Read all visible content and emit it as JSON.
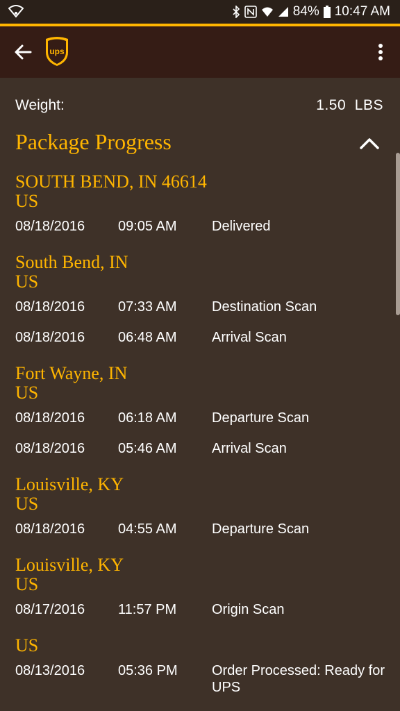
{
  "status_bar": {
    "battery": "84%",
    "time": "10:47 AM"
  },
  "summary": {
    "weight_label": "Weight:",
    "weight_value": "1.50  LBS"
  },
  "progress": {
    "title": "Package Progress",
    "groups": [
      {
        "city": "SOUTH BEND, IN 46614",
        "country": "US",
        "events": [
          {
            "date": "08/18/2016",
            "time": "09:05 AM",
            "activity": "Delivered"
          }
        ]
      },
      {
        "city": "South Bend, IN",
        "country": "US",
        "events": [
          {
            "date": "08/18/2016",
            "time": "07:33 AM",
            "activity": "Destination Scan"
          },
          {
            "date": "08/18/2016",
            "time": "06:48 AM",
            "activity": "Arrival Scan"
          }
        ]
      },
      {
        "city": "Fort Wayne, IN",
        "country": "US",
        "events": [
          {
            "date": "08/18/2016",
            "time": "06:18 AM",
            "activity": "Departure Scan"
          },
          {
            "date": "08/18/2016",
            "time": "05:46 AM",
            "activity": "Arrival Scan"
          }
        ]
      },
      {
        "city": "Louisville, KY",
        "country": "US",
        "events": [
          {
            "date": "08/18/2016",
            "time": "04:55 AM",
            "activity": "Departure Scan"
          }
        ]
      },
      {
        "city": "Louisville, KY",
        "country": "US",
        "events": [
          {
            "date": "08/17/2016",
            "time": "11:57 PM",
            "activity": "Origin Scan"
          }
        ]
      },
      {
        "city": "",
        "country": "US",
        "events": [
          {
            "date": "08/13/2016",
            "time": "05:36 PM",
            "activity": "Order Processed: Ready for UPS"
          }
        ]
      }
    ]
  },
  "colors": {
    "accent": "#ffb500",
    "background": "#3e3128",
    "app_bar": "#351c15"
  },
  "icons": {
    "back": "arrow-left-icon",
    "menu": "more-vert-icon",
    "collapse": "chevron-up-icon",
    "logo": "ups-shield-logo"
  }
}
